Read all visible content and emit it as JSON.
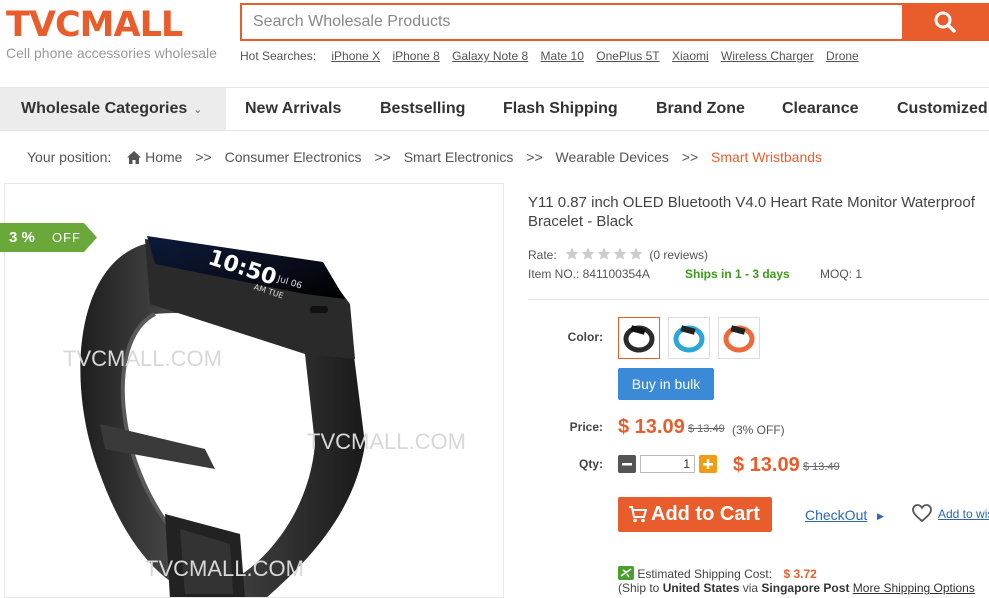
{
  "header": {
    "logo_text": "TVCMALL",
    "tagline": "Cell phone accessories wholesale",
    "search_placeholder": "Search Wholesale Products",
    "hot_label": "Hot Searches:",
    "hot_items": [
      "iPhone X",
      "iPhone 8",
      "Galaxy Note 8",
      "Mate 10",
      "OnePlus 5T",
      "Xiaomi",
      "Wireless Charger",
      "Drone"
    ],
    "brand_color": "#e95d2d"
  },
  "nav": {
    "categories": "Wholesale Categories",
    "items": [
      "New Arrivals",
      "Bestselling",
      "Flash Shipping",
      "Brand Zone",
      "Clearance",
      "Customized"
    ]
  },
  "breadcrumb": {
    "label": "Your position:",
    "home": "Home",
    "sep": ">>",
    "items": [
      "Consumer Electronics",
      "Smart Electronics",
      "Wearable Devices"
    ],
    "current": "Smart Wristbands"
  },
  "product": {
    "badge_pct": "3 %",
    "badge_off": "OFF",
    "watermark": "TVCMALL.COM",
    "screen_time": "10:50",
    "screen_date": "Jul 06",
    "screen_day": "AM TUE",
    "title": "Y11 0.87 inch OLED Bluetooth V4.0 Heart Rate Monitor Waterproof Bracelet - Black",
    "rate_label": "Rate:",
    "rating": 0,
    "reviews": "(0 reviews)",
    "item_no": "Item NO.: 841100354A",
    "ships": "Ships in 1 - 3 days",
    "moq": "MOQ: 1",
    "color_label": "Color:",
    "colors": [
      {
        "name": "Black",
        "hex": "#2b2b2b"
      },
      {
        "name": "Blue",
        "hex": "#2aa7d6"
      },
      {
        "name": "Orange",
        "hex": "#ee6a3a"
      }
    ],
    "selected_color": 0,
    "bulk_label": "Buy in bulk",
    "price_label": "Price:",
    "price": "$ 13.09",
    "old_price": "$ 13.49",
    "discount": "(3% OFF)",
    "qty_label": "Qty:",
    "qty": "1",
    "qty_price": "$ 13.09",
    "qty_old_price": "$ 13.49",
    "cart_label": "Add to Cart",
    "checkout_label": "CheckOut",
    "wishlist_label": "Add to wishlist",
    "shipping_label": "Estimated Shipping Cost:",
    "shipping_cost": "$ 3.72",
    "ship_to_prefix": "(Ship to",
    "ship_to_country": "United States",
    "ship_via": "via",
    "ship_method": "Singapore Post",
    "more_options": "More Shipping Options"
  }
}
